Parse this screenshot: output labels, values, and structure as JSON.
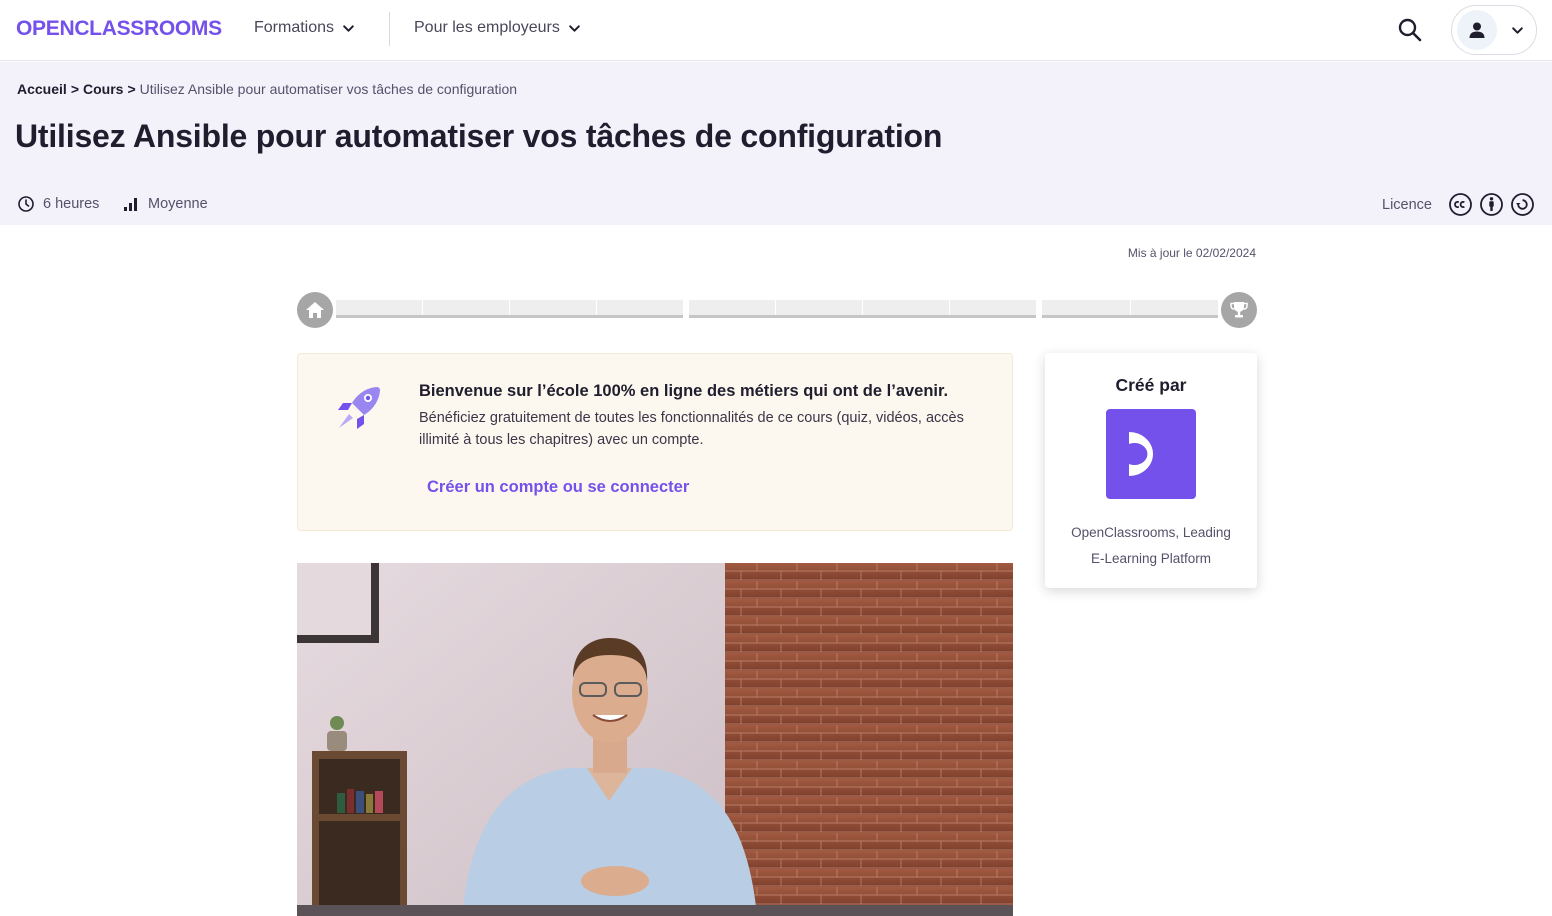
{
  "nav": {
    "logo": "OPENCLASSROOMS",
    "formations_label": "Formations",
    "employeurs_label": "Pour les employeurs"
  },
  "breadcrumb": {
    "home": "Accueil",
    "sep1": ">",
    "courses": "Cours",
    "sep2": ">",
    "current": "Utilisez Ansible pour automatiser vos tâches de configuration"
  },
  "course": {
    "title": "Utilisez Ansible pour automatiser vos tâches de configuration",
    "duration": "6 heures",
    "level": "Moyenne",
    "licence_label": "Licence",
    "updated": "Mis à jour le 02/02/2024"
  },
  "progress": {
    "parts": [
      {
        "steps": 4
      },
      {
        "steps": 4
      },
      {
        "steps": 2
      }
    ],
    "completed": 0
  },
  "welcome": {
    "title": "Bienvenue sur l’école 100% en ligne des métiers qui ont de l’avenir.",
    "text": "Bénéficiez gratuitement de toutes les fonctionnalités de ce cours (quiz, vidéos, accès illimité à tous les chapitres) avec un compte.",
    "link": "Créer un compte ou se connecter"
  },
  "creator": {
    "title": "Créé par",
    "name": "OpenClassrooms, Leading E-Learning Platform"
  },
  "colors": {
    "brand": "#7451eb",
    "header_bg": "#f3f2fb",
    "welcome_bg": "#fcf8ef"
  },
  "icons": [
    "search-icon",
    "user-icon",
    "chevron-down-icon",
    "clock-icon",
    "bar-chart-icon",
    "cc-icon",
    "by-icon",
    "sa-icon",
    "home-icon",
    "trophy-icon",
    "rocket-icon"
  ]
}
